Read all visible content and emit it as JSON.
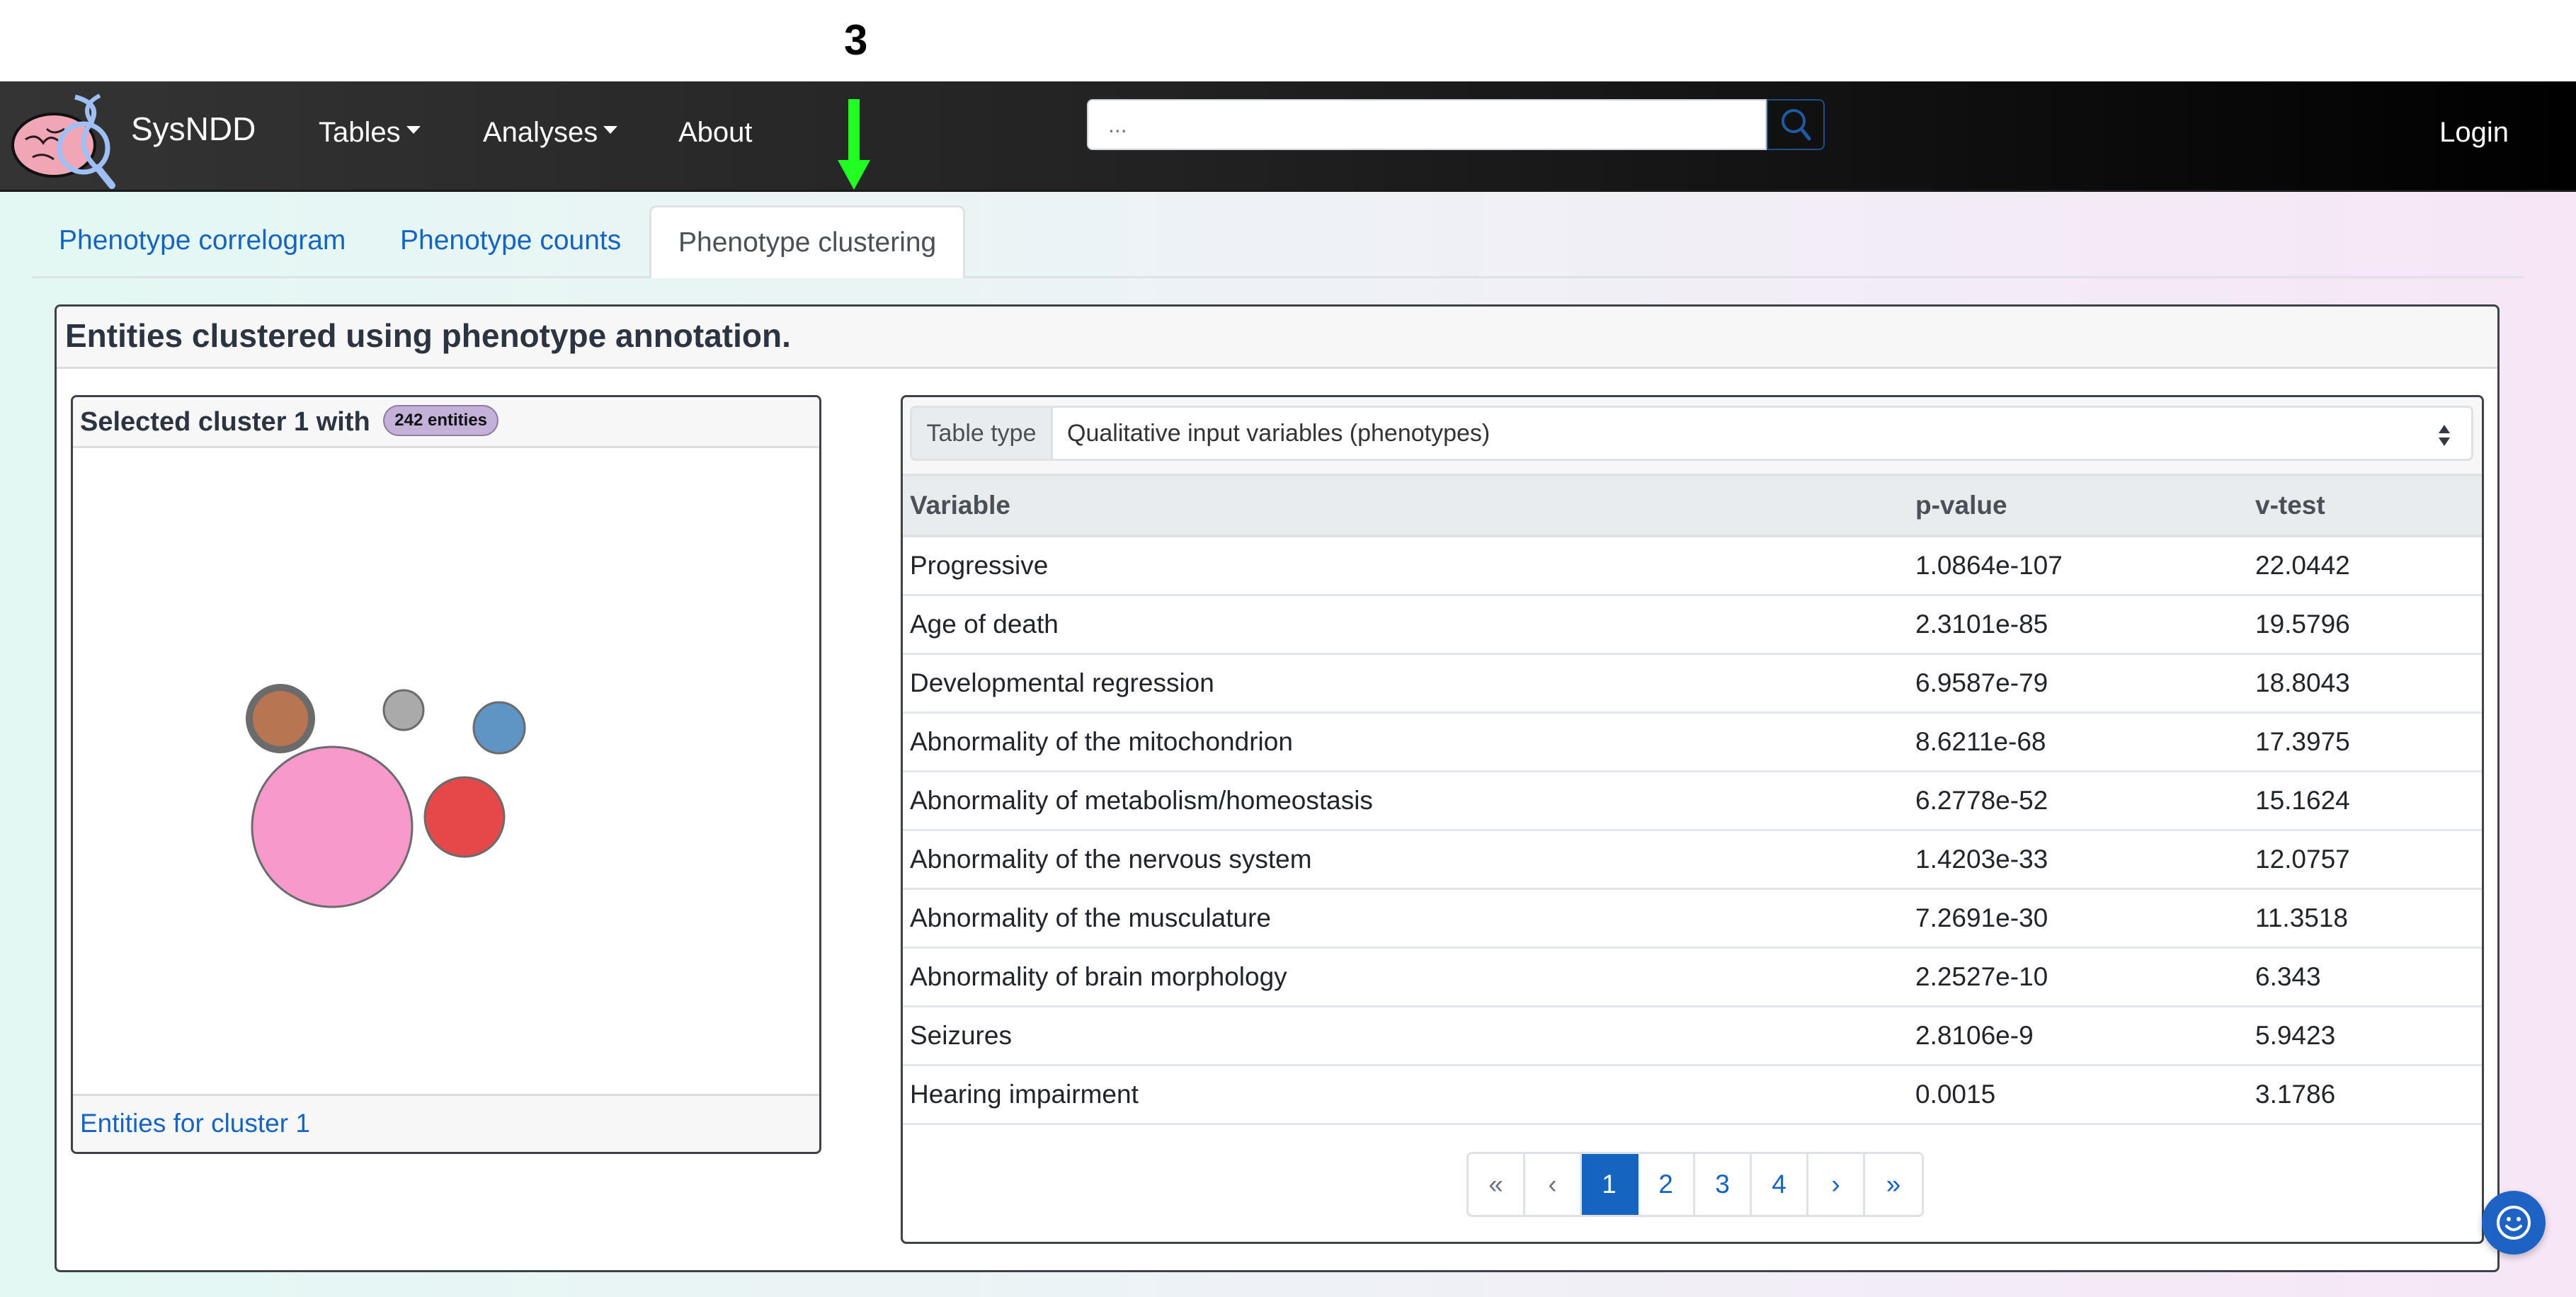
{
  "annotation": {
    "label": "3",
    "arrow_color": "#22ff22"
  },
  "navbar": {
    "brand": "SysNDD",
    "items": [
      {
        "label": "Tables",
        "dropdown": true
      },
      {
        "label": "Analyses",
        "dropdown": true
      },
      {
        "label": "About",
        "dropdown": false
      }
    ],
    "search": {
      "placeholder": "...",
      "value": ""
    },
    "login_label": "Login"
  },
  "tabs": [
    {
      "label": "Phenotype correlogram",
      "active": false
    },
    {
      "label": "Phenotype counts",
      "active": false
    },
    {
      "label": "Phenotype clustering",
      "active": true
    }
  ],
  "main": {
    "title": "Entities clustered using phenotype annotation.",
    "cluster_panel": {
      "title": "Selected cluster 1 with",
      "badge": "242 entities",
      "footer_link": "Entities for cluster 1",
      "bubbles": [
        {
          "name": "cluster-1",
          "color": "#f79acb",
          "size": 242,
          "selected": false
        },
        {
          "name": "cluster-2",
          "color": "#e6484a",
          "size": 60,
          "selected": false
        },
        {
          "name": "cluster-3",
          "color": "#b87552",
          "size": 42,
          "selected": true
        },
        {
          "name": "cluster-4",
          "color": "#5f95c5",
          "size": 30,
          "selected": false
        },
        {
          "name": "cluster-5",
          "color": "#aaaaaa",
          "size": 15,
          "selected": false
        }
      ]
    },
    "table_panel": {
      "select_label": "Table type",
      "select_value": "Qualitative input variables (phenotypes)",
      "columns": [
        "Variable",
        "p-value",
        "v-test"
      ],
      "rows": [
        [
          "Progressive",
          "1.0864e-107",
          "22.0442"
        ],
        [
          "Age of death",
          "2.3101e-85",
          "19.5796"
        ],
        [
          "Developmental regression",
          "6.9587e-79",
          "18.8043"
        ],
        [
          "Abnormality of the mitochondrion",
          "8.6211e-68",
          "17.3975"
        ],
        [
          "Abnormality of metabolism/homeostasis",
          "6.2778e-52",
          "15.1624"
        ],
        [
          "Abnormality of the nervous system",
          "1.4203e-33",
          "12.0757"
        ],
        [
          "Abnormality of the musculature",
          "7.2691e-30",
          "11.3518"
        ],
        [
          "Abnormality of brain morphology",
          "2.2527e-10",
          "6.343"
        ],
        [
          "Seizures",
          "2.8106e-9",
          "5.9423"
        ],
        [
          "Hearing impairment",
          "0.0015",
          "3.1786"
        ]
      ],
      "pagination": {
        "first": "«",
        "prev": "‹",
        "pages": [
          "1",
          "2",
          "3",
          "4"
        ],
        "current": "1",
        "next": "›",
        "last": "»"
      }
    }
  },
  "fab": {
    "icon": "smiley-icon"
  }
}
